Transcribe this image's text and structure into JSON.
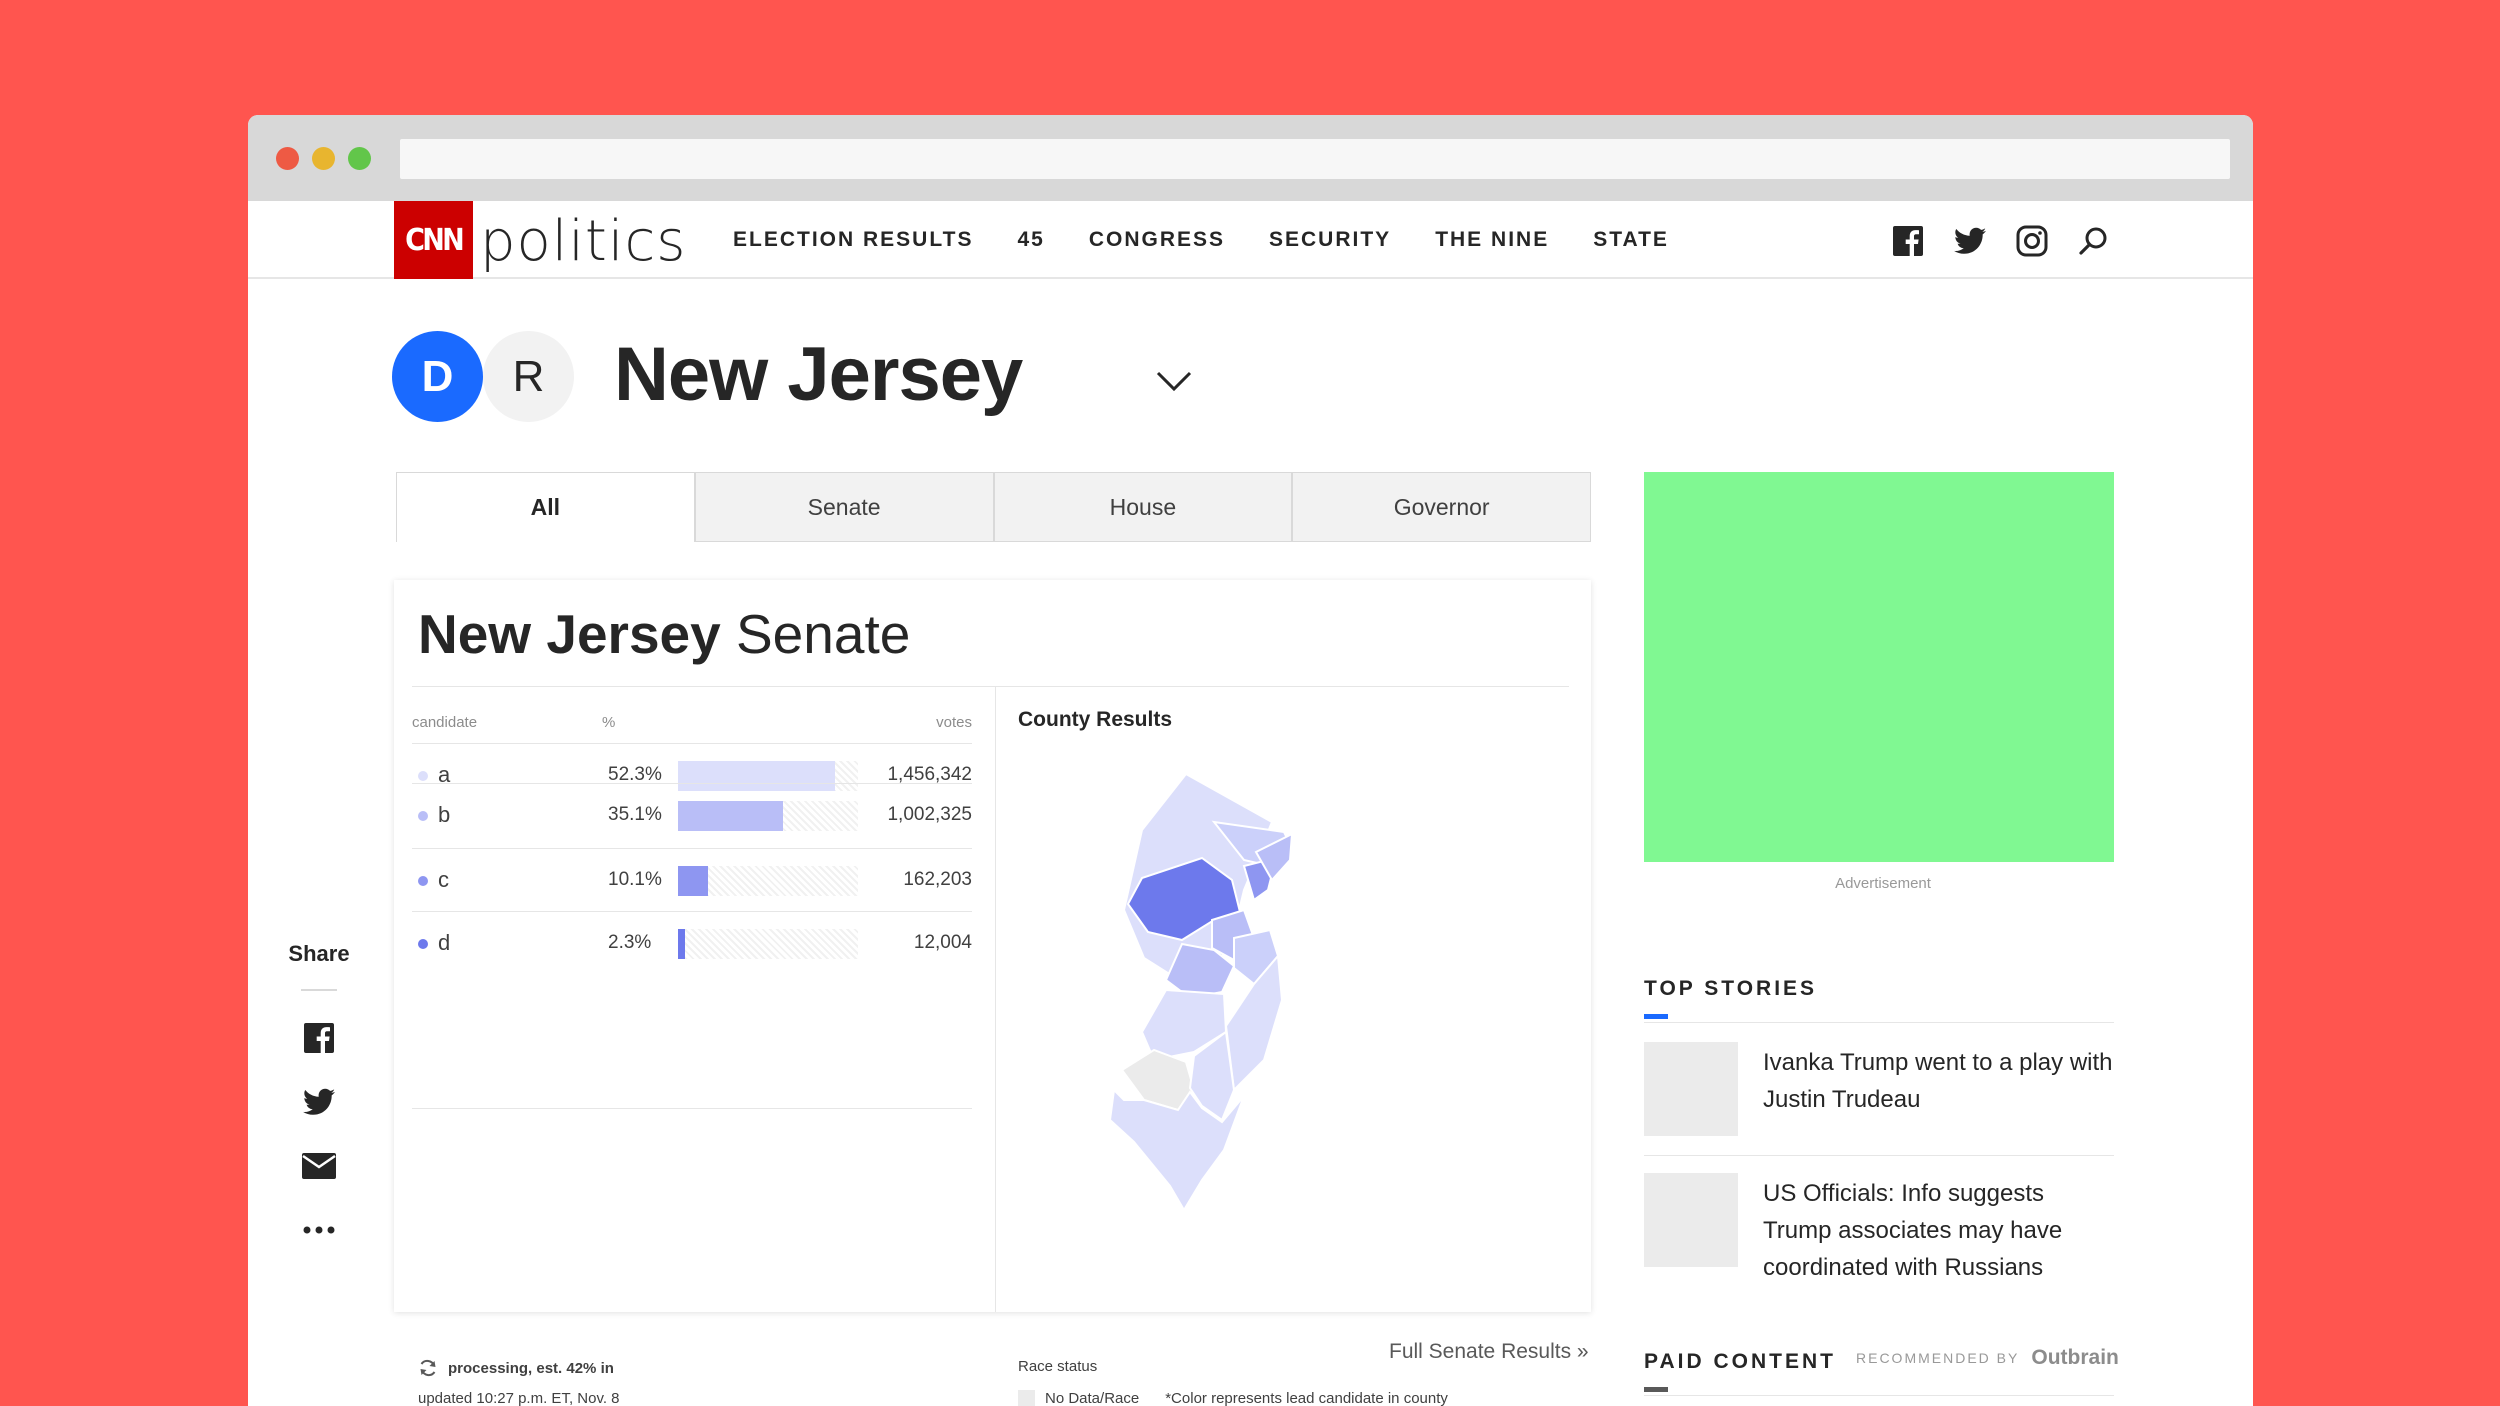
{
  "nav": {
    "logo": "CNN",
    "wordmark": "politics",
    "links": [
      "ELECTION RESULTS",
      "45",
      "CONGRESS",
      "SECURITY",
      "THE NINE",
      "STATE"
    ],
    "icons": [
      "facebook-icon",
      "twitter-icon",
      "instagram-icon",
      "search-icon"
    ]
  },
  "header": {
    "party_d": "D",
    "party_r": "R",
    "state": "New Jersey"
  },
  "tabs": [
    "All",
    "Senate",
    "House",
    "Governor"
  ],
  "race": {
    "title_bold": "New Jersey",
    "title_rest": "Senate",
    "columns": {
      "candidate": "candidate",
      "pct": "%",
      "votes": "votes"
    },
    "candidates": [
      {
        "name": "a",
        "pct": "52.3%",
        "share": 0.523,
        "votes": "1,456,342",
        "color": "#DCDFFB"
      },
      {
        "name": "b",
        "pct": "35.1%",
        "share": 0.351,
        "votes": "1,002,325",
        "color": "#B9BEF7"
      },
      {
        "name": "c",
        "pct": "10.1%",
        "share": 0.101,
        "votes": "162,203",
        "color": "#8E96F1"
      },
      {
        "name": "d",
        "pct": "2.3%",
        "share": 0.023,
        "votes": "12,004",
        "color": "#6D79EC"
      }
    ],
    "status": "processing, est. 42% in",
    "updated": "updated 10:27 p.m. ET, Nov. 8",
    "county_title": "County Results",
    "race_status": "Race status",
    "legend_no_data": "No Data/Race",
    "legend_note": "*Color represents lead candidate in county",
    "full_results": "Full Senate Results »"
  },
  "share": {
    "label": "Share",
    "icons": [
      "facebook-icon",
      "twitter-icon",
      "email-icon",
      "more-icon"
    ]
  },
  "sidebar": {
    "ad_label": "Advertisement",
    "top_stories_title": "TOP STORIES",
    "stories": [
      {
        "headline": "Ivanka Trump went to a play with Justin Trudeau"
      },
      {
        "headline": "US Officials: Info suggests Trump associates may have coordinated with Russians"
      }
    ],
    "paid_title": "PAID CONTENT",
    "recommended_by": "RECOMMENDED BY",
    "outbrain": "Outbrain"
  },
  "colors": {
    "background": "#FF554F",
    "democrat": "#1A6AFF",
    "cnn_red": "#CC0000",
    "ad": "#80F892",
    "top_stories_accent": "#1A6AFF",
    "paid_accent": "#595959"
  }
}
